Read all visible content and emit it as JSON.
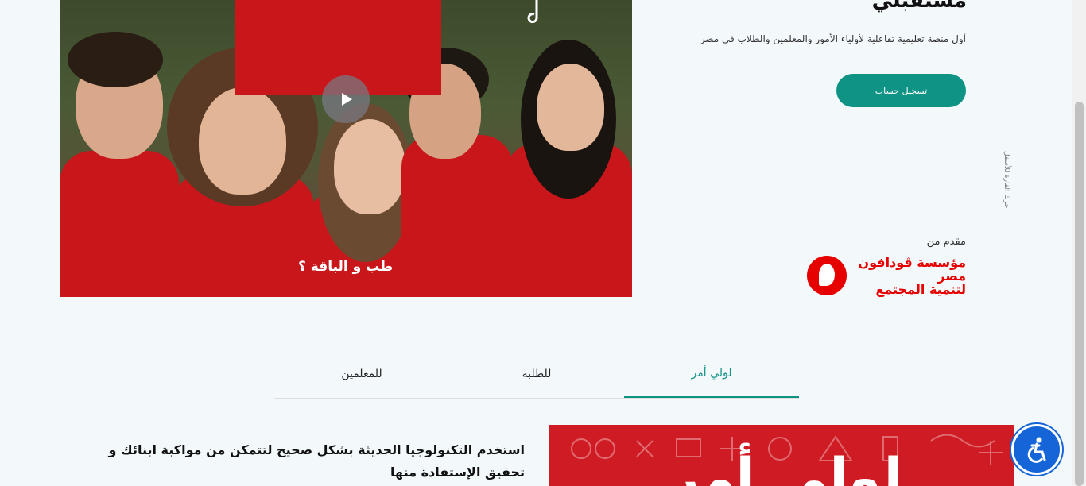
{
  "hero": {
    "title": "مستقبلي",
    "subtitle": "أول منصة تعليمية تفاعلية لأولياء الأمور والمعلمين والطلاب في مصر",
    "register_label": "تسجيل حساب",
    "scroll_hint": "حرك الفارة للأسفل",
    "presented_by": "مقدم من",
    "sponsor_lines": [
      "مؤسسة ڤودافون",
      "مصر",
      "لتنمية المجتمع"
    ]
  },
  "video": {
    "caption": "طب و الباقة ؟"
  },
  "tabs": [
    {
      "label": "لولي أمر",
      "active": true
    },
    {
      "label": "للطلبة",
      "active": false
    },
    {
      "label": "للمعلمين",
      "active": false
    }
  ],
  "content": {
    "text": "استخدم التكنولوجيا الحديثة بشكل صحيح لتتمكن من مواكبة ابنائك و تحقيق الإستفادة منها",
    "banner_text": "لولي أمر"
  },
  "colors": {
    "accent": "#0f9384",
    "brand_red": "#e60000",
    "accessibility_blue": "#1565d8"
  },
  "icons": {
    "play": "play-icon",
    "accessibility": "accessibility-icon",
    "sponsor_logo": "vodafone-logo"
  }
}
